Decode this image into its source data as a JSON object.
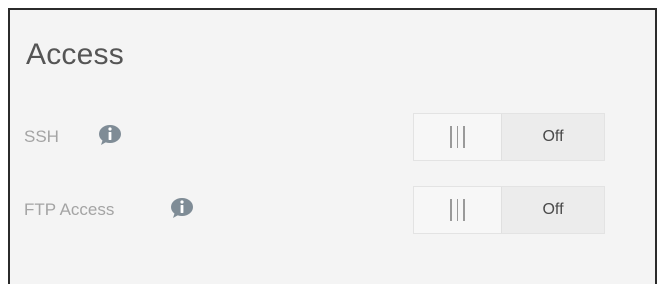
{
  "section": {
    "title": "Access"
  },
  "settings": [
    {
      "label": "SSH",
      "state": "Off",
      "info_icon": "info-icon"
    },
    {
      "label": "FTP Access",
      "state": "Off",
      "info_icon": "info-icon"
    }
  ],
  "colors": {
    "panel_bg": "#f4f4f4",
    "border": "#2b2b2b",
    "info_icon": "#7f8c96"
  }
}
